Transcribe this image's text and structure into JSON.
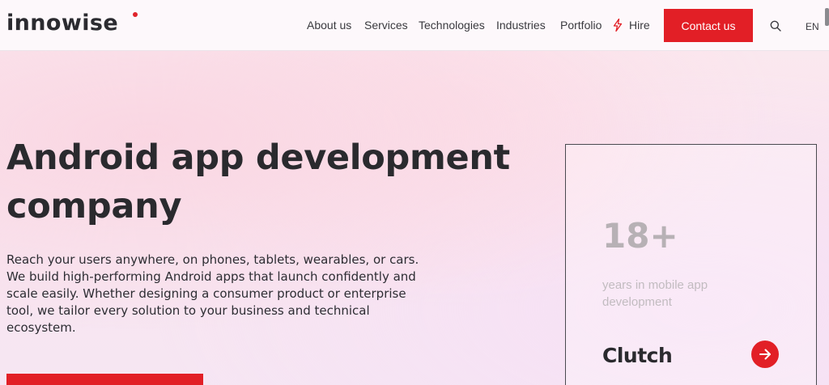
{
  "header": {
    "logo": "innowise",
    "nav": [
      "About us",
      "Services",
      "Technologies",
      "Industries",
      "Portfolio"
    ],
    "hire_label": "Hire",
    "contact_label": "Contact us",
    "language": "EN"
  },
  "hero": {
    "title_line1": "Android app development",
    "title_line2": "company",
    "description": "Reach your users anywhere, on phones, tablets, wearables, or cars. We build high-performing Android apps that launch confidently and scale easily. Whether designing a consumer product or enterprise tool, we tailor every solution to your business and technical ecosystem."
  },
  "stat_card": {
    "number": "18+",
    "label": "years in mobile app development",
    "review_brand": "Clutch"
  },
  "colors": {
    "accent": "#e21f26",
    "text": "#2a2a2e"
  },
  "icons": [
    "lightning-icon",
    "search-icon",
    "arrow-right-icon"
  ]
}
